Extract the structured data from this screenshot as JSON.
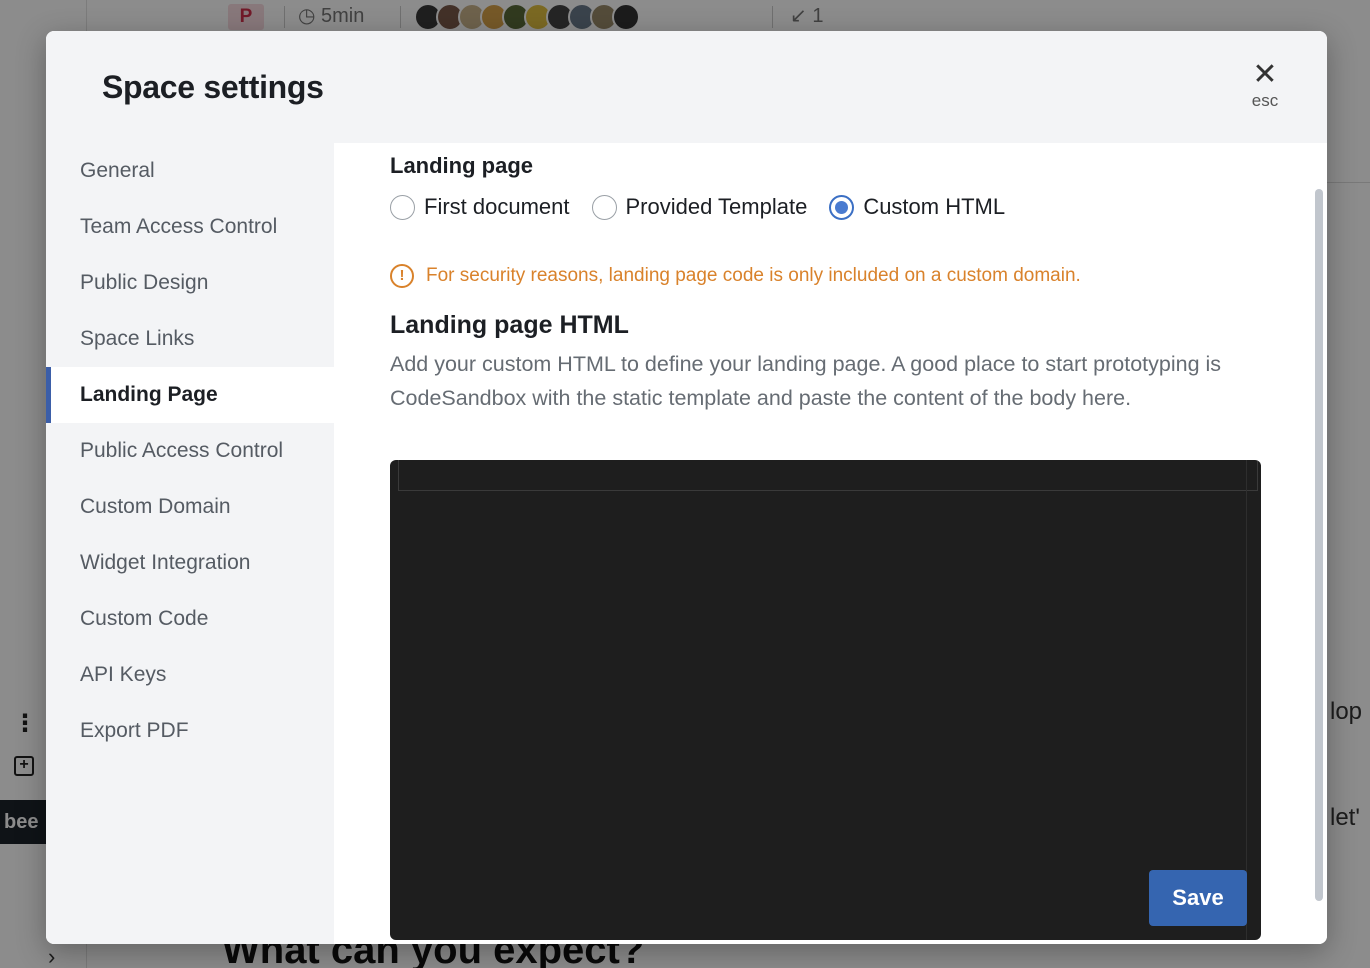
{
  "background": {
    "badge": "P",
    "read_time": "5min",
    "link_count": "1",
    "heading": "What can you expect?",
    "side_tag": "bee",
    "right_text_1": "lop",
    "right_text_2": "let'",
    "avatar_colors": [
      "#3a3a3a",
      "#7a5a4a",
      "#c9b38a",
      "#d8a24a",
      "#5a6a3a",
      "#e0c040",
      "#444",
      "#6a7a8a",
      "#9a8a6a",
      "#333"
    ]
  },
  "modal": {
    "title": "Space settings",
    "close_label": "esc",
    "sidebar": {
      "items": [
        {
          "label": "General"
        },
        {
          "label": "Team Access Control"
        },
        {
          "label": "Public Design"
        },
        {
          "label": "Space Links"
        },
        {
          "label": "Landing Page"
        },
        {
          "label": "Public Access Control"
        },
        {
          "label": "Custom Domain"
        },
        {
          "label": "Widget Integration"
        },
        {
          "label": "Custom Code"
        },
        {
          "label": "API Keys"
        },
        {
          "label": "Export PDF"
        }
      ],
      "active": "Landing Page"
    },
    "content": {
      "section_label": "Landing page",
      "options": [
        {
          "label": "First document",
          "checked": false
        },
        {
          "label": "Provided Template",
          "checked": false
        },
        {
          "label": "Custom HTML",
          "checked": true
        }
      ],
      "warning": "For security reasons, landing page code is only included on a custom domain.",
      "html_title": "Landing page HTML",
      "html_description": "Add your custom HTML to define your landing page. A good place to start prototyping is CodeSandbox with the static template and paste the content of the body here.",
      "editor_value": "",
      "save_label": "Save"
    }
  },
  "colors": {
    "accent": "#3565b0",
    "warning": "#d9822b",
    "editor_bg": "#1e1e1e"
  }
}
